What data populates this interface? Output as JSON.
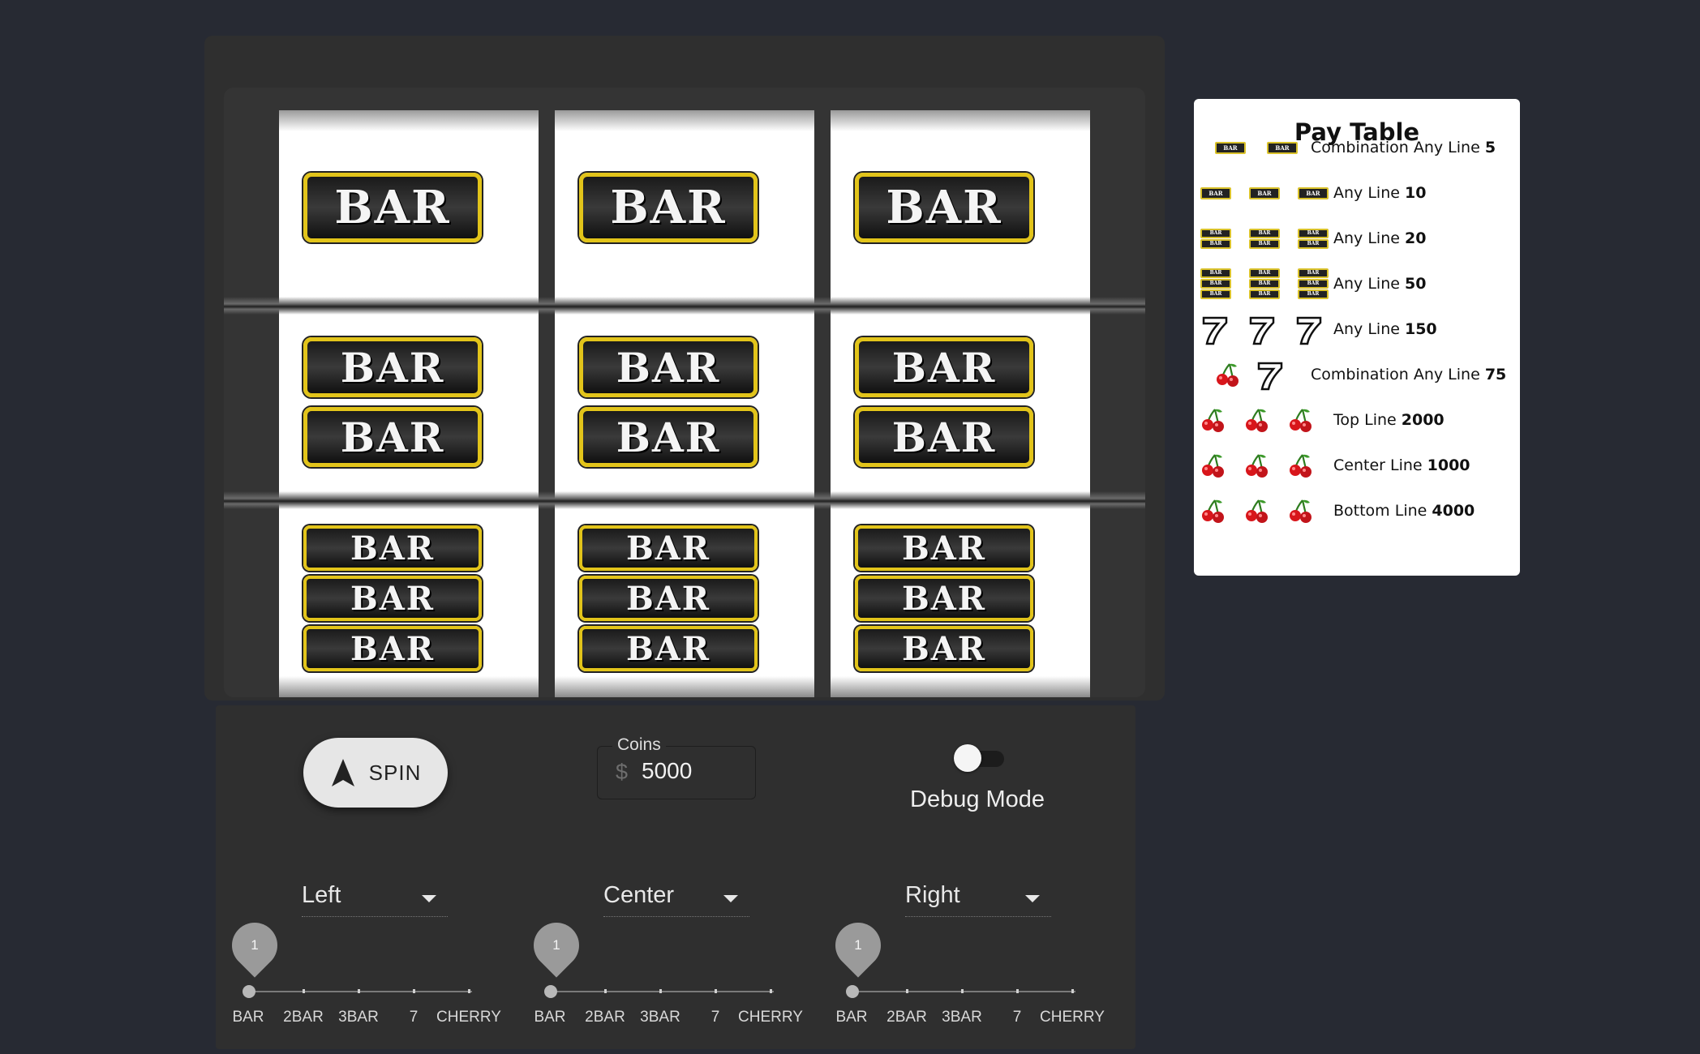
{
  "reels": {
    "symbols": {
      "bar": "BAR"
    }
  },
  "paytable": {
    "title": "Pay Table",
    "rows": [
      {
        "icons": [
          "bar-icon",
          "bar-icon"
        ],
        "label": "Combination Any Line",
        "value": "5"
      },
      {
        "icons": [
          "bar-icon",
          "bar-icon",
          "bar-icon"
        ],
        "label": "Any Line",
        "value": "10"
      },
      {
        "icons": [
          "2bar-icon",
          "2bar-icon",
          "2bar-icon"
        ],
        "label": "Any Line",
        "value": "20"
      },
      {
        "icons": [
          "3bar-icon",
          "3bar-icon",
          "3bar-icon"
        ],
        "label": "Any Line",
        "value": "50"
      },
      {
        "icons": [
          "seven-icon",
          "seven-icon",
          "seven-icon"
        ],
        "label": "Any Line",
        "value": "150"
      },
      {
        "icons": [
          "cherry-icon",
          "seven-icon"
        ],
        "label": "Combination Any Line",
        "value": "75"
      },
      {
        "icons": [
          "cherry-icon",
          "cherry-icon",
          "cherry-icon"
        ],
        "label": "Top Line",
        "value": "2000"
      },
      {
        "icons": [
          "cherry-icon",
          "cherry-icon",
          "cherry-icon"
        ],
        "label": "Center Line",
        "value": "1000"
      },
      {
        "icons": [
          "cherry-icon",
          "cherry-icon",
          "cherry-icon"
        ],
        "label": "Bottom Line",
        "value": "4000"
      }
    ]
  },
  "controls": {
    "spin_label": "SPIN",
    "coins_label": "Coins",
    "coins_currency": "$",
    "coins_value": "5000",
    "debug_label": "Debug Mode",
    "debug_on": false,
    "selects": [
      {
        "value": "Left"
      },
      {
        "value": "Center"
      },
      {
        "value": "Right"
      }
    ],
    "sliders": [
      {
        "value": "1",
        "labels": [
          "BAR",
          "2BAR",
          "3BAR",
          "7",
          "CHERRY"
        ]
      },
      {
        "value": "1",
        "labels": [
          "BAR",
          "2BAR",
          "3BAR",
          "7",
          "CHERRY"
        ]
      },
      {
        "value": "1",
        "labels": [
          "BAR",
          "2BAR",
          "3BAR",
          "7",
          "CHERRY"
        ]
      }
    ]
  },
  "colors": {
    "background": "#272a33",
    "panel": "#2f2f2f",
    "bar_border": "#e2c41a"
  }
}
